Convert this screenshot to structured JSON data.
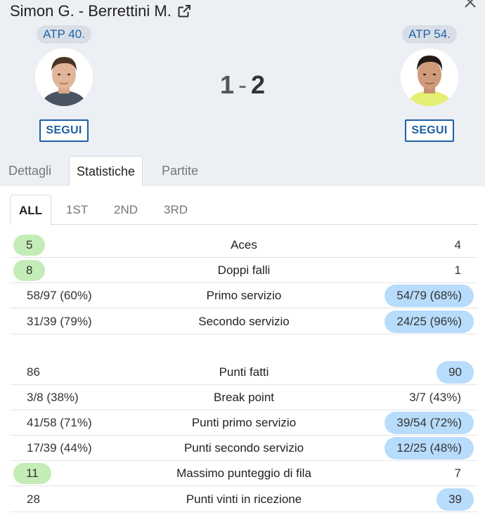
{
  "match": {
    "title": "Simon G. - Berrettini M."
  },
  "player1": {
    "rank": "ATP 40.",
    "follow": "SEGUI"
  },
  "player2": {
    "rank": "ATP 54.",
    "follow": "SEGUI"
  },
  "score": {
    "p1": "1",
    "sep": "-",
    "p2": "2"
  },
  "main_tabs": [
    "Dettagli",
    "Statistiche",
    "Partite"
  ],
  "sub_tabs": [
    "ALL",
    "1ST",
    "2ND",
    "3RD"
  ],
  "stats": [
    {
      "label": "Aces",
      "left": "5",
      "right": "4",
      "winner": "left"
    },
    {
      "label": "Doppi falli",
      "left": "8",
      "right": "1",
      "winner": "left"
    },
    {
      "label": "Primo servizio",
      "left": "58/97 (60%)",
      "right": "54/79 (68%)",
      "winner": "right"
    },
    {
      "label": "Secondo servizio",
      "left": "31/39 (79%)",
      "right": "24/25 (96%)",
      "winner": "right"
    },
    {
      "label": "Punti fatti",
      "left": "86",
      "right": "90",
      "winner": "right"
    },
    {
      "label": "Break point",
      "left": "3/8 (38%)",
      "right": "3/7 (43%)",
      "winner": "none"
    },
    {
      "label": "Punti primo servizio",
      "left": "41/58 (71%)",
      "right": "39/54 (72%)",
      "winner": "right"
    },
    {
      "label": "Punti secondo servizio",
      "left": "17/39 (44%)",
      "right": "12/25 (48%)",
      "winner": "right"
    },
    {
      "label": "Massimo punteggio di fila",
      "left": "11",
      "right": "7",
      "winner": "left"
    },
    {
      "label": "Punti vinti in ricezione",
      "left": "28",
      "right": "39",
      "winner": "right"
    }
  ],
  "colors": {
    "accent": "#1e5fa3",
    "left_highlight": "#c4ecb7",
    "right_highlight": "#b8dcfb"
  },
  "icons": {
    "title_icon": "external-link-icon",
    "close": "close-icon"
  }
}
